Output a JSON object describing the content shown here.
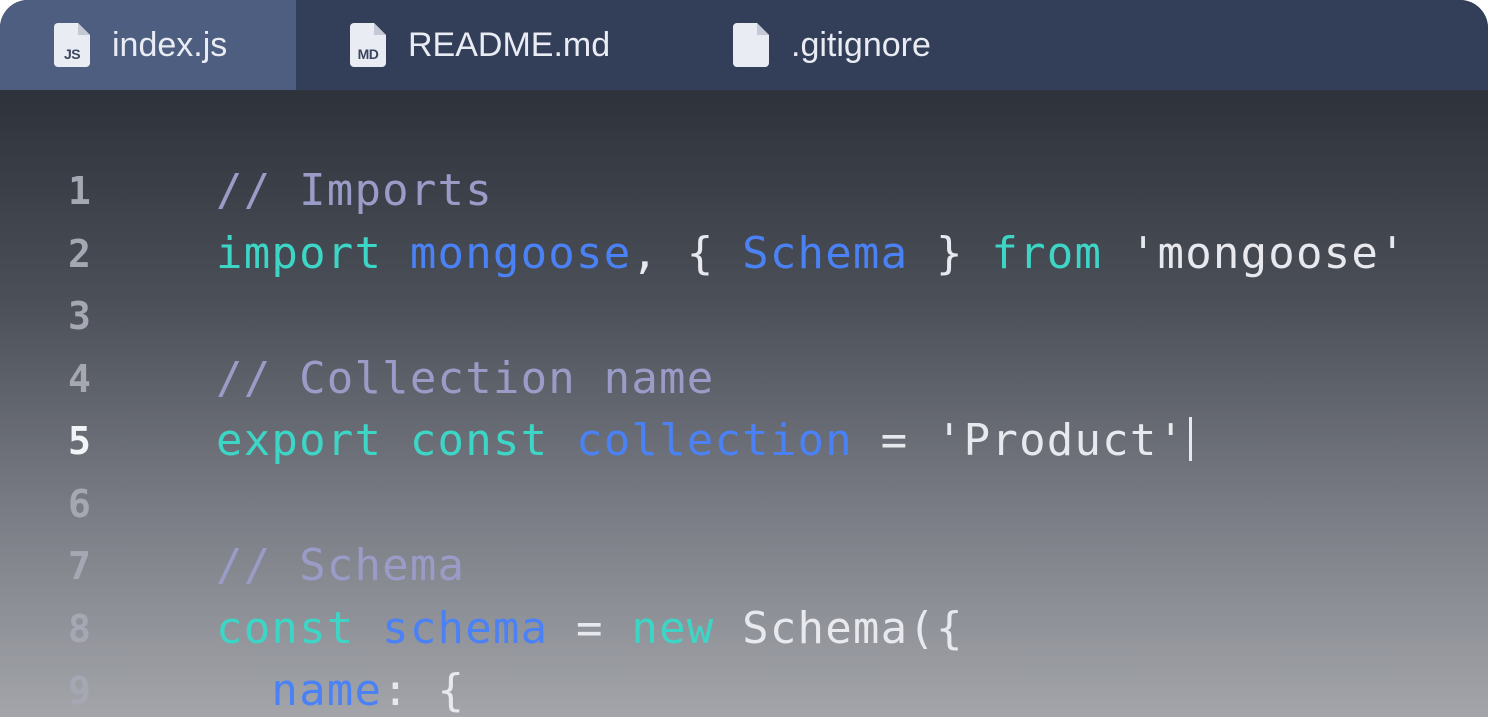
{
  "tabs": [
    {
      "label": "index.js",
      "icon": "js-file-icon",
      "badge": "JS",
      "active": true
    },
    {
      "label": "README.md",
      "icon": "markdown-file-icon",
      "badge": "MD",
      "active": false
    },
    {
      "label": ".gitignore",
      "icon": "file-icon",
      "badge": "",
      "active": false
    }
  ],
  "colors": {
    "keyword": "#3dd6c6",
    "identifier": "#4a82f5",
    "comment": "#9a9cc7",
    "plain": "#e8e9ee",
    "tabbar": "#333e59",
    "active_tab": "#4e5e80"
  },
  "editor": {
    "current_line": 5,
    "lines": [
      {
        "num": "1",
        "tokens": [
          {
            "t": "// Imports",
            "k": "comment"
          }
        ]
      },
      {
        "num": "2",
        "tokens": [
          {
            "t": "import",
            "k": "keyword"
          },
          {
            "t": " ",
            "k": "plain"
          },
          {
            "t": "mongoose",
            "k": "identifier"
          },
          {
            "t": ", { ",
            "k": "plain"
          },
          {
            "t": "Schema",
            "k": "identifier"
          },
          {
            "t": " } ",
            "k": "plain"
          },
          {
            "t": "from",
            "k": "keyword"
          },
          {
            "t": " 'mongoose'",
            "k": "plain"
          }
        ]
      },
      {
        "num": "3",
        "tokens": []
      },
      {
        "num": "4",
        "tokens": [
          {
            "t": "// Collection name",
            "k": "comment"
          }
        ]
      },
      {
        "num": "5",
        "tokens": [
          {
            "t": "export",
            "k": "keyword"
          },
          {
            "t": " ",
            "k": "plain"
          },
          {
            "t": "const",
            "k": "keyword"
          },
          {
            "t": " ",
            "k": "plain"
          },
          {
            "t": "collection",
            "k": "identifier"
          },
          {
            "t": " = 'Product'",
            "k": "plain"
          }
        ],
        "cursor": true
      },
      {
        "num": "6",
        "tokens": []
      },
      {
        "num": "7",
        "tokens": [
          {
            "t": "// Schema",
            "k": "comment"
          }
        ]
      },
      {
        "num": "8",
        "tokens": [
          {
            "t": "const",
            "k": "keyword"
          },
          {
            "t": " ",
            "k": "plain"
          },
          {
            "t": "schema",
            "k": "identifier"
          },
          {
            "t": " = ",
            "k": "plain"
          },
          {
            "t": "new",
            "k": "keyword"
          },
          {
            "t": " Schema({",
            "k": "plain"
          }
        ]
      },
      {
        "num": "9",
        "tokens": [
          {
            "t": "  ",
            "k": "plain"
          },
          {
            "t": "name",
            "k": "identifier"
          },
          {
            "t": ": {",
            "k": "plain"
          }
        ]
      }
    ]
  }
}
